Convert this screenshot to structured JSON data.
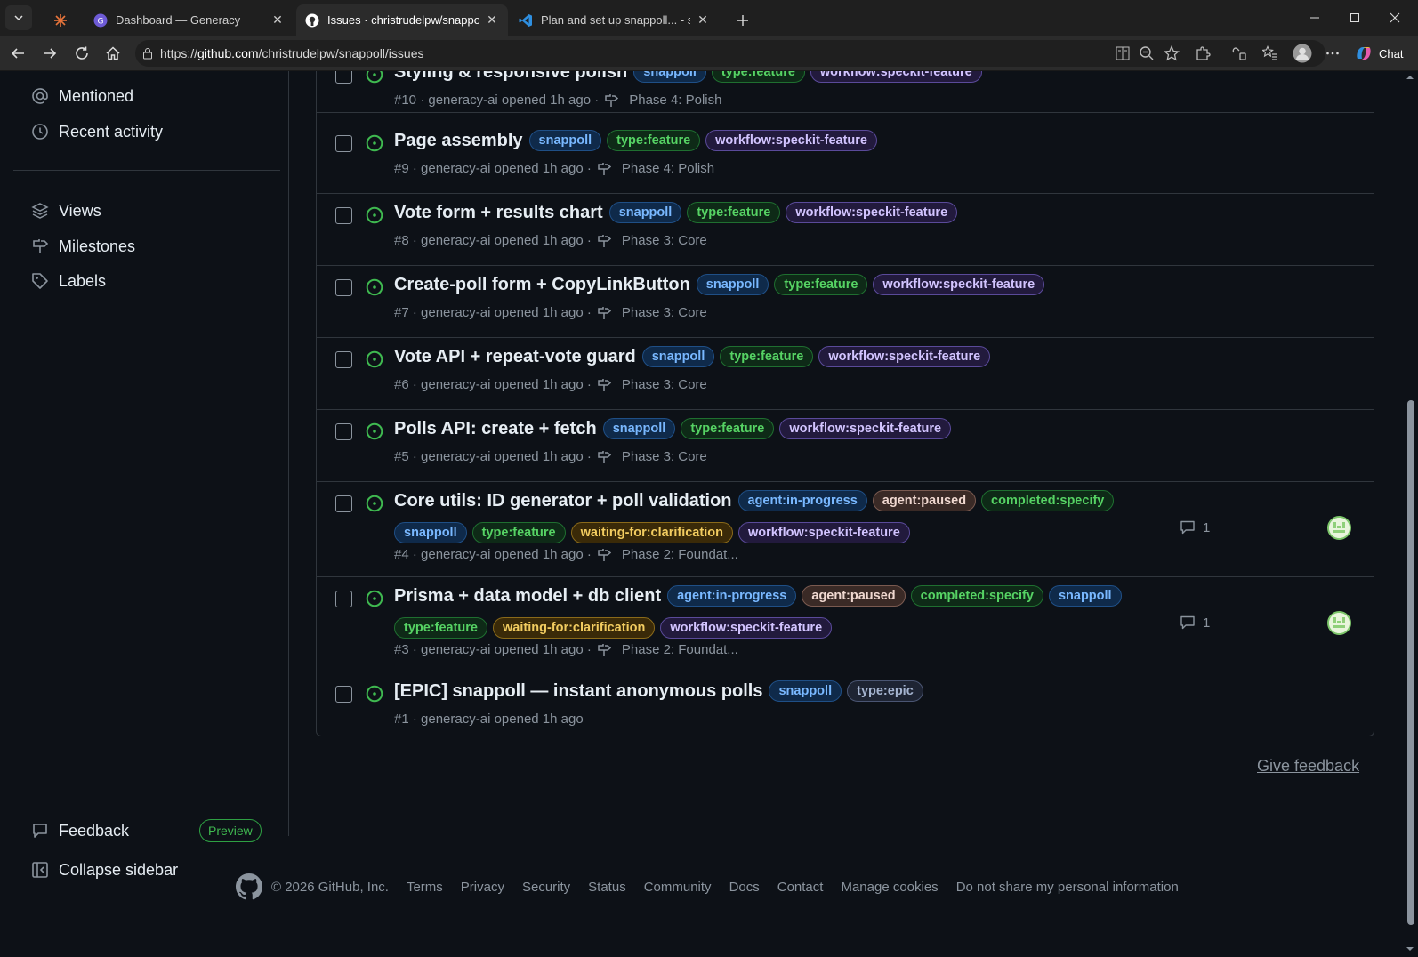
{
  "browser": {
    "tabs": [
      {
        "title": "",
        "icon": "generacy-star-icon"
      },
      {
        "title": "Dashboard — Generacy",
        "icon": "generacy-g-icon"
      },
      {
        "title": "Issues · christrudelpw/snappoll",
        "icon": "github-icon",
        "active": true
      },
      {
        "title": "Plan and set up snappoll... - snapp",
        "icon": "vscode-icon"
      }
    ],
    "url_prefix": "https://",
    "url_host": "github.com",
    "url_path": "/christrudelpw/snappoll/issues",
    "chat_label": "Chat"
  },
  "sidebar": {
    "top_items": [
      {
        "label": "Mentioned",
        "icon": "at-icon"
      },
      {
        "label": "Recent activity",
        "icon": "clock-icon"
      }
    ],
    "section_items": [
      {
        "label": "Views",
        "icon": "stack-icon"
      },
      {
        "label": "Milestones",
        "icon": "milestone-icon"
      },
      {
        "label": "Labels",
        "icon": "tag-icon"
      }
    ],
    "feedback_label": "Feedback",
    "preview_badge": "Preview",
    "collapse_label": "Collapse sidebar"
  },
  "issues": [
    {
      "title": "Styling & responsive polish",
      "labels": [
        "snappoll",
        "type:feature",
        "workflow:speckit-feature"
      ],
      "number": "#10",
      "author": "generacy-ai",
      "opened": "opened 1h ago",
      "milestone": "Phase 4: Polish"
    },
    {
      "title": "Page assembly",
      "labels": [
        "snappoll",
        "type:feature",
        "workflow:speckit-feature"
      ],
      "number": "#9",
      "author": "generacy-ai",
      "opened": "opened 1h ago",
      "milestone": "Phase 4: Polish"
    },
    {
      "title": "Vote form + results chart",
      "labels": [
        "snappoll",
        "type:feature",
        "workflow:speckit-feature"
      ],
      "number": "#8",
      "author": "generacy-ai",
      "opened": "opened 1h ago",
      "milestone": "Phase 3: Core"
    },
    {
      "title": "Create-poll form + CopyLinkButton",
      "labels": [
        "snappoll",
        "type:feature",
        "workflow:speckit-feature"
      ],
      "number": "#7",
      "author": "generacy-ai",
      "opened": "opened 1h ago",
      "milestone": "Phase 3: Core"
    },
    {
      "title": "Vote API + repeat-vote guard",
      "labels": [
        "snappoll",
        "type:feature",
        "workflow:speckit-feature"
      ],
      "number": "#6",
      "author": "generacy-ai",
      "opened": "opened 1h ago",
      "milestone": "Phase 3: Core"
    },
    {
      "title": "Polls API: create + fetch",
      "labels": [
        "snappoll",
        "type:feature",
        "workflow:speckit-feature"
      ],
      "number": "#5",
      "author": "generacy-ai",
      "opened": "opened 1h ago",
      "milestone": "Phase 3: Core"
    },
    {
      "title": "Core utils: ID generator + poll validation",
      "labels": [
        "agent:in-progress",
        "agent:paused",
        "completed:specify",
        "snappoll",
        "type:feature",
        "waiting-for:clarification",
        "workflow:speckit-feature"
      ],
      "number": "#4",
      "author": "generacy-ai",
      "opened": "opened 1h ago",
      "milestone": "Phase 2: Foundat...",
      "comments": "1",
      "has_avatar": true
    },
    {
      "title": "Prisma + data model + db client",
      "labels": [
        "agent:in-progress",
        "agent:paused",
        "completed:specify",
        "snappoll",
        "type:feature",
        "waiting-for:clarification",
        "workflow:speckit-feature"
      ],
      "number": "#3",
      "author": "generacy-ai",
      "opened": "opened 1h ago",
      "milestone": "Phase 2: Foundat...",
      "comments": "1",
      "has_avatar": true
    },
    {
      "title": "[EPIC] snappoll — instant anonymous polls",
      "labels": [
        "snappoll",
        "type:epic"
      ],
      "number": "#1",
      "author": "generacy-ai",
      "opened": "opened 1h ago",
      "milestone": ""
    }
  ],
  "label_colors": {
    "snappoll": {
      "fg": "#79b8ff",
      "bg": "#0f2a4a",
      "border": "#1f4f86"
    },
    "type:feature": {
      "fg": "#56d364",
      "bg": "#0e2a17",
      "border": "#1f6f30"
    },
    "workflow:speckit-feature": {
      "fg": "#d2c4ff",
      "bg": "#221a3d",
      "border": "#5a4a9a"
    },
    "agent:in-progress": {
      "fg": "#79b8ff",
      "bg": "#0f2a4a",
      "border": "#1f4f86"
    },
    "agent:paused": {
      "fg": "#f0d8d0",
      "bg": "#3a2a26",
      "border": "#7a5a50"
    },
    "completed:specify": {
      "fg": "#56d364",
      "bg": "#0e2a17",
      "border": "#1f6f30"
    },
    "waiting-for:clarification": {
      "fg": "#f2cc60",
      "bg": "#3a2a08",
      "border": "#8a6a1a"
    },
    "type:epic": {
      "fg": "#a5b4d0",
      "bg": "#1e2433",
      "border": "#4a5572"
    }
  },
  "give_feedback": "Give feedback",
  "footer": {
    "copyright": "© 2026 GitHub, Inc.",
    "links": [
      "Terms",
      "Privacy",
      "Security",
      "Status",
      "Community",
      "Docs",
      "Contact",
      "Manage cookies",
      "Do not share my personal information"
    ]
  }
}
